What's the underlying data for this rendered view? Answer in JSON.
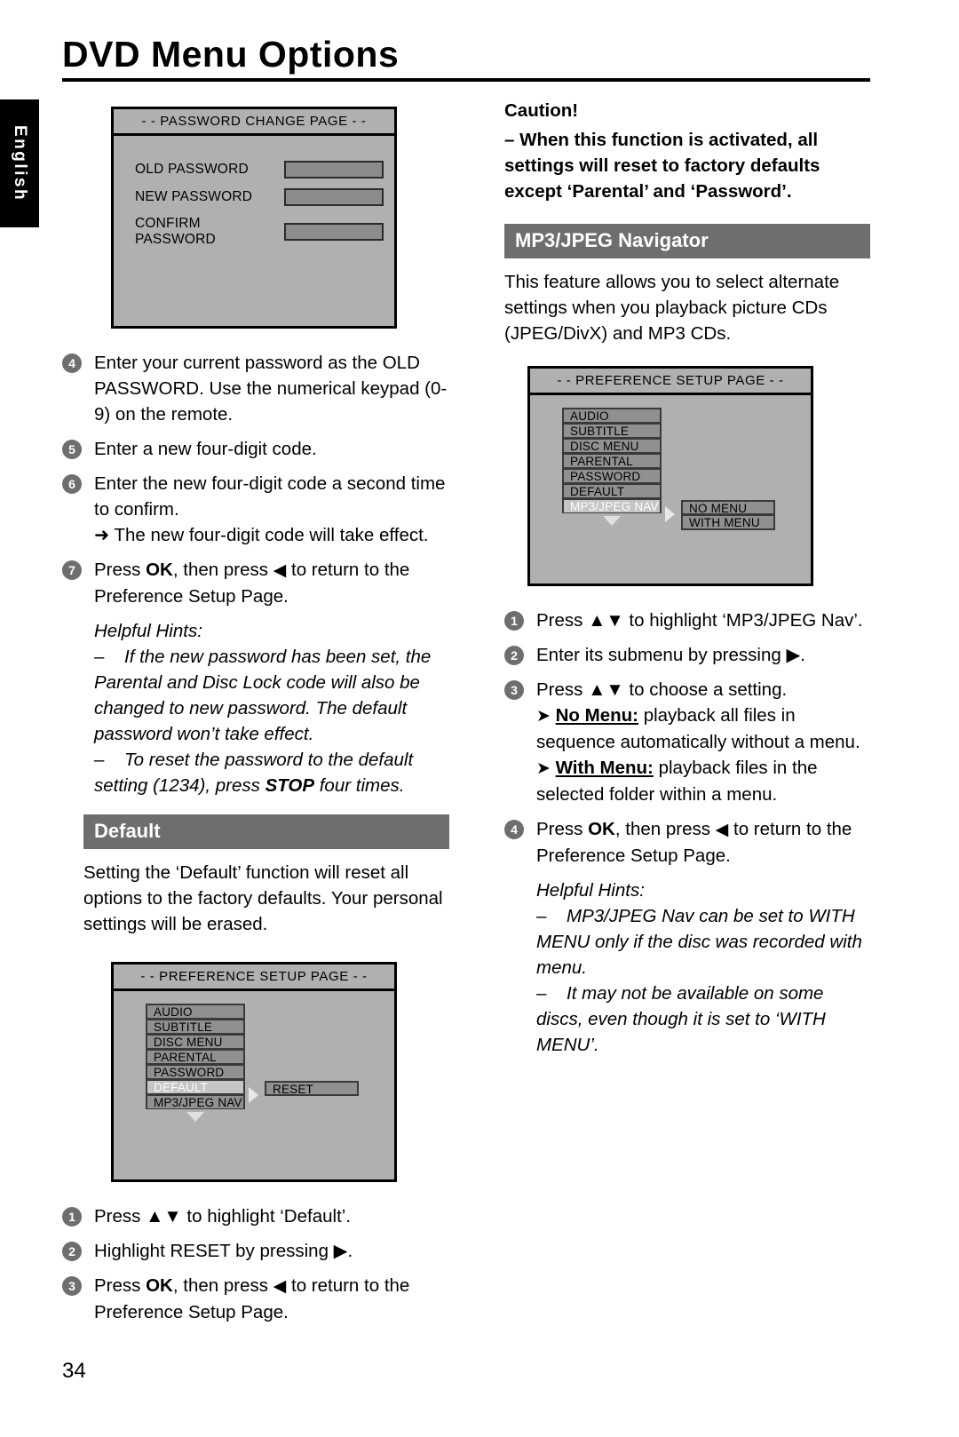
{
  "language_tab": "English",
  "page_title": "DVD Menu Options",
  "page_number": "34",
  "left_column": {
    "password_screen": {
      "title": "- - PASSWORD CHANGE PAGE - -",
      "fields": [
        {
          "label": "OLD PASSWORD",
          "value": ""
        },
        {
          "label": "NEW PASSWORD",
          "value": ""
        },
        {
          "label": "CONFIRM PASSWORD",
          "value": ""
        }
      ]
    },
    "steps": [
      {
        "num": "4",
        "text": "Enter your current password as the OLD PASSWORD. Use the numerical keypad (0-9) on the remote."
      },
      {
        "num": "5",
        "text": "Enter a new four-digit code."
      },
      {
        "num": "6",
        "text": "Enter the new four-digit code a second time to confirm.",
        "sub": "➜ The new four-digit code will take effect."
      },
      {
        "num": "7",
        "text_pre": "Press ",
        "bold": "OK",
        "text_mid": ", then press ",
        "arrow": "◀",
        "text_post": " to return to the Preference Setup Page."
      }
    ],
    "hints_title": "Helpful Hints:",
    "hints": [
      "If the new password has been set, the Parental and Disc Lock code will also be changed to new password. The default password won’t take effect.",
      "To reset the password to the default setting (1234), press STOP four times."
    ],
    "hint2_pre": "To reset the password to the default setting (1234), press ",
    "hint2_bold": "STOP",
    "hint2_post": " four times.",
    "default_section": {
      "heading": "Default",
      "body": "Setting the ‘Default’ function will reset all options to the factory defaults. Your personal settings will be erased."
    },
    "pref_screen": {
      "title": "- - PREFERENCE SETUP PAGE - -",
      "menu": [
        "AUDIO",
        "SUBTITLE",
        "DISC MENU",
        "PARENTAL",
        "PASSWORD",
        "DEFAULT",
        "MP3/JPEG NAV"
      ],
      "highlighted": "DEFAULT",
      "submenu": [
        "RESET"
      ]
    },
    "default_steps": [
      {
        "num": "1",
        "text_pre": "Press ",
        "glyph": "▲▼",
        "text_post": " to highlight ‘Default’."
      },
      {
        "num": "2",
        "text_pre": "Highlight RESET by pressing ",
        "glyph": "▶",
        "text_post": "."
      },
      {
        "num": "3",
        "text_pre": "Press ",
        "bold": "OK",
        "text_mid": ", then press ",
        "arrow": "◀",
        "text_post": " to return to the Preference Setup Page."
      }
    ]
  },
  "right_column": {
    "caution_title": "Caution!",
    "caution_body": "–  When this function is activated, all settings will reset to factory defaults except ‘Parental’ and ‘Password’.",
    "mp3_section": {
      "heading": "MP3/JPEG Navigator",
      "body": "This feature allows you to select alternate settings when you playback picture CDs (JPEG/DivX) and MP3 CDs."
    },
    "pref_screen": {
      "title": "- - PREFERENCE SETUP PAGE - -",
      "menu": [
        "AUDIO",
        "SUBTITLE",
        "DISC MENU",
        "PARENTAL",
        "PASSWORD",
        "DEFAULT",
        "MP3/JPEG NAV"
      ],
      "highlighted": "MP3/JPEG NAV",
      "submenu": [
        "NO MENU",
        "WITH MENU"
      ]
    },
    "steps": [
      {
        "num": "1",
        "text_pre": "Press ",
        "glyph": "▲▼",
        "text_post": " to highlight ‘MP3/JPEG Nav’."
      },
      {
        "num": "2",
        "text_pre": "Enter its submenu by pressing ",
        "glyph": "▶",
        "text_post": "."
      },
      {
        "num": "3",
        "text_pre": "Press ",
        "glyph": "▲▼",
        "text_post": " to choose a setting."
      },
      {
        "num": "4",
        "text_pre": "Press ",
        "bold": "OK",
        "text_mid": ", then press ",
        "arrow": "◀",
        "text_post": " to return to the Preference Setup Page."
      }
    ],
    "no_menu_label": "No Menu:",
    "no_menu_text": " playback all files in sequence automatically without a menu.",
    "with_menu_label": "With Menu:",
    "with_menu_text": " playback files in the selected folder within a menu.",
    "hints_title": "Helpful Hints:",
    "hints": [
      "MP3/JPEG Nav can be set to WITH MENU only if the disc was recorded with menu.",
      "It may not be available on some discs, even though it is set to ‘WITH MENU’."
    ]
  },
  "colors": {
    "accent_bar": "#6e6e6e",
    "osd_background": "#b0b0b0",
    "osd_item": "#909090",
    "osd_highlight": "#c5c5c5",
    "field_fill": "#8c8c8c"
  }
}
